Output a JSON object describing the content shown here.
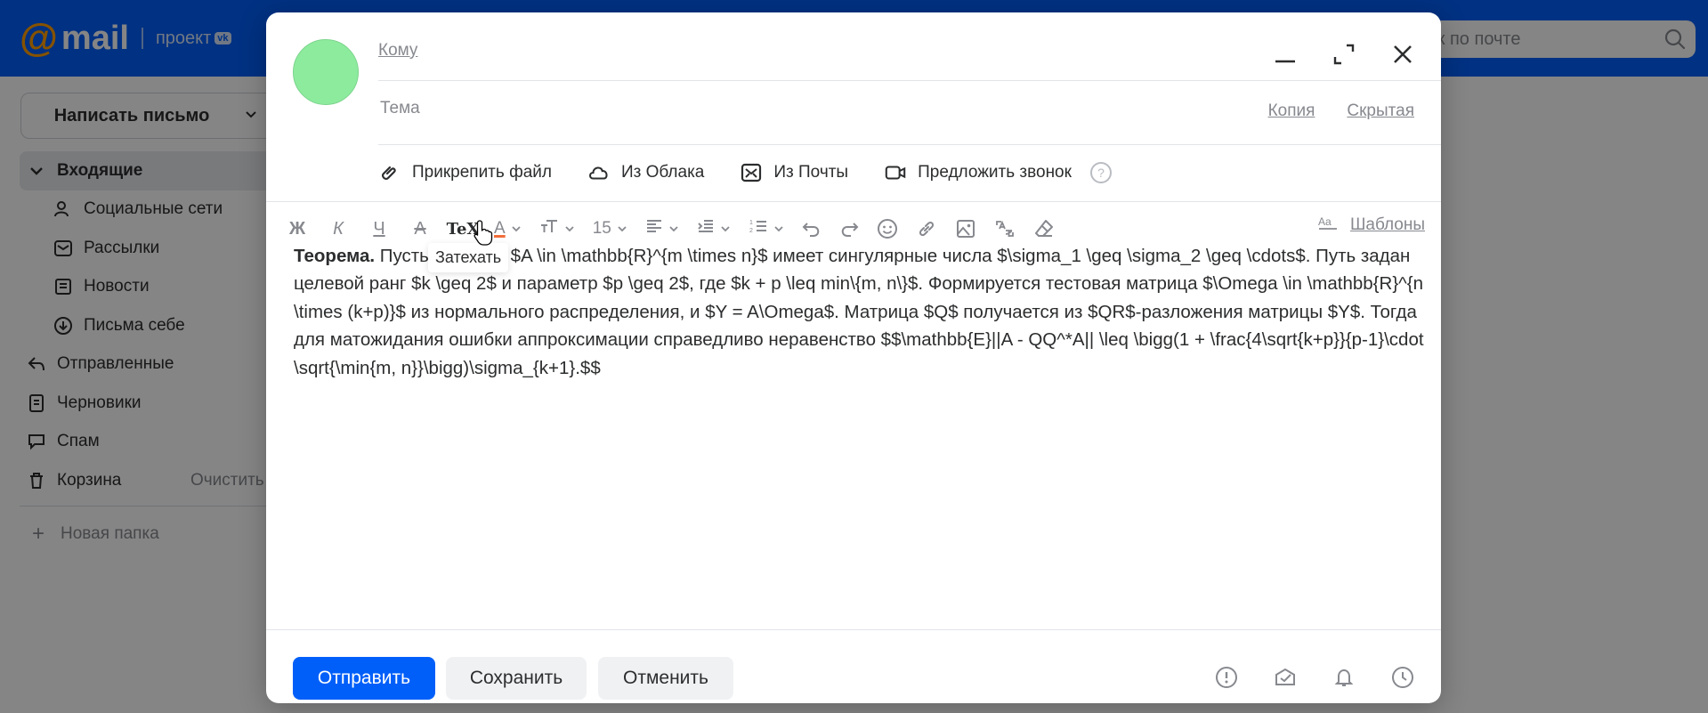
{
  "app": {
    "logo_mail": "mail",
    "logo_project": "проект",
    "logo_vk": "vk",
    "search_placeholder": "Поиск по почте"
  },
  "sidebar": {
    "compose_label": "Написать письмо",
    "items": [
      {
        "label": "Входящие",
        "icon": "chevron-down-icon",
        "active": true
      },
      {
        "label": "Социальные сети",
        "icon": "people-icon"
      },
      {
        "label": "Рассылки",
        "icon": "newsletter-icon"
      },
      {
        "label": "Новости",
        "icon": "news-icon"
      },
      {
        "label": "Письма себе",
        "icon": "self-mail-icon"
      },
      {
        "label": "Отправленные",
        "icon": "sent-icon"
      },
      {
        "label": "Черновики",
        "icon": "drafts-icon"
      },
      {
        "label": "Спам",
        "icon": "spam-icon"
      },
      {
        "label": "Корзина",
        "icon": "trash-icon",
        "extra": "Очистить"
      }
    ],
    "new_folder": "Новая папка"
  },
  "compose": {
    "to_label": "Кому",
    "subject_placeholder": "Тема",
    "cc_label": "Копия",
    "bcc_label": "Скрытая",
    "attach_file": "Прикрепить файл",
    "from_cloud": "Из Облака",
    "from_mail": "Из Почты",
    "offer_call": "Предложить звонок",
    "toolbar": {
      "bold": "Ж",
      "italic": "К",
      "underline": "Ч",
      "strike": "A",
      "tex": "TeX",
      "text_color": "A",
      "font_size": "15",
      "templates": "Шаблоны"
    },
    "tooltip": "Затехать",
    "body_bold": "Теорема.",
    "body_text": " Пусть матрица $A \\in \\mathbb{R}^{m \\times n}$ имеет сингулярные числа $\\sigma_1 \\geq \\sigma_2 \\geq \\cdots$. Путь задан целевой ранг $k \\geq 2$ и параметр $p \\geq 2$, где $k + p \\leq min\\{m, n\\}$. Формируется тестовая матрица $\\Omega \\in \\mathbb{R}^{n \\times (k+p)}$ из нормального распределения, и $Y = A\\Omega$. Матрица $Q$ получается из $QR$-разложения матрицы $Y$. Тогда для матожидания ошибки аппроксимации справедливо неравенство $$\\mathbb{E}||A - QQ^*A|| \\leq \\bigg(1 + \\frac{4\\sqrt{k+p}}{p-1}\\cdot \\sqrt{\\min{m, n}}\\bigg)\\sigma_{k+1}.$$",
    "send": "Отправить",
    "save": "Сохранить",
    "cancel": "Отменить"
  },
  "colors": {
    "brand_blue": "#005ff9",
    "logo_orange": "#ff9e00",
    "avatar_green": "#8deb9e"
  }
}
